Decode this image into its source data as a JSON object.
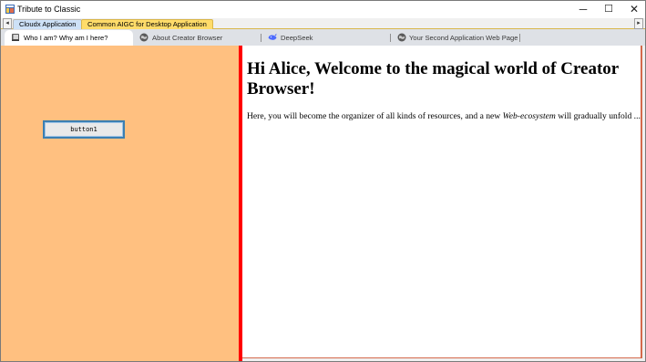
{
  "window": {
    "title": "Tribute to Classic",
    "minimize_glyph": "─",
    "maximize_glyph": "☐",
    "close_glyph": "✕"
  },
  "outer_tabs": {
    "scroll_left": "◂",
    "scroll_right": "▸",
    "items": [
      {
        "label": "Cloudx Application",
        "active": false
      },
      {
        "label": "Common AIGC for Desktop Application",
        "active": true
      }
    ]
  },
  "inner_tabs": [
    {
      "label": "Who I am? Why am I here?",
      "icon": "book-icon",
      "active": true
    },
    {
      "label": "About Creator Browser",
      "icon": "globe-icon",
      "active": false
    },
    {
      "label": "DeepSeek",
      "icon": "deepseek-whale-icon",
      "active": false
    },
    {
      "label": "Your Second Application Web Page",
      "icon": "globe-icon",
      "active": false
    }
  ],
  "left_panel": {
    "button_label": "button1",
    "background": "#ffc080"
  },
  "content": {
    "heading": "Hi Alice, Welcome to the magical world of Creator Browser!",
    "para_before": "Here, you will become the organizer of all kinds of resources, and a new ",
    "para_em": "Web-ecosystem",
    "para_after": " will gradually unfold ..."
  },
  "colors": {
    "splitter": "#ff0000",
    "active_outer_tab": "#ffdc6a",
    "inactive_outer_tab": "#cde1f7",
    "tab_strip": "#dee1e6"
  }
}
